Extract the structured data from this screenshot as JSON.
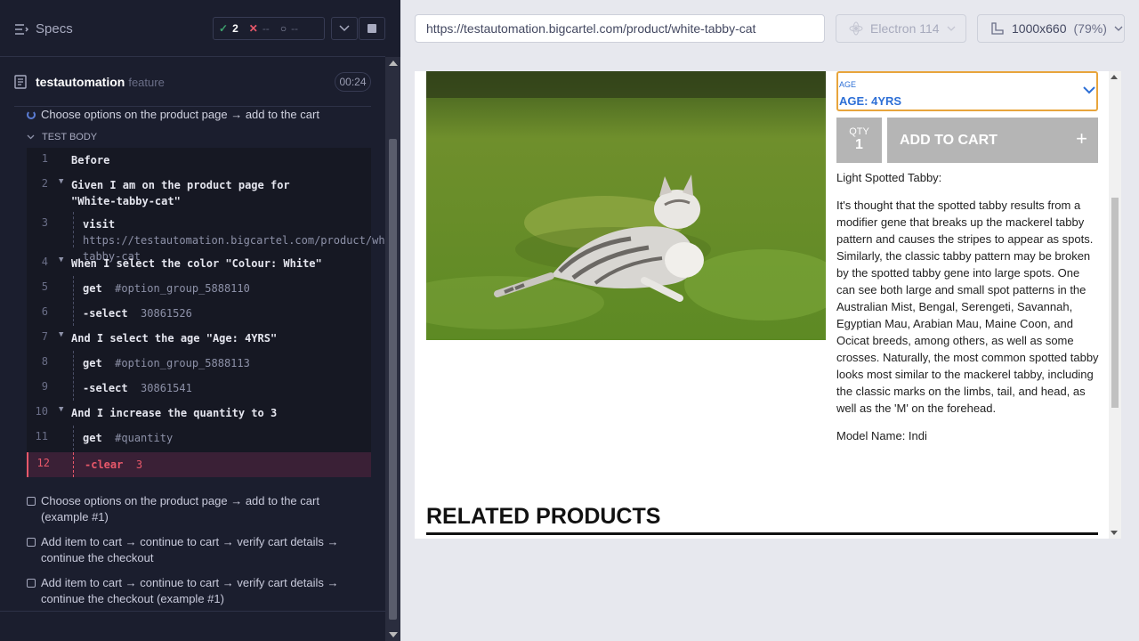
{
  "runner": {
    "specs_label": "Specs",
    "passed": "2",
    "failed": "--",
    "pending": "--",
    "file_name": "testautomation",
    "file_tag": "feature",
    "timer": "00:24",
    "running_test": "Choose options on the product page → add to the cart",
    "test_body_label": "TEST BODY",
    "commands": [
      {
        "num": "1",
        "text": "Before"
      },
      {
        "num": "2",
        "text": "Given  I am on the product page for \"White-tabby-cat\""
      },
      {
        "num": "3",
        "key": "visit",
        "value": "https://testautomation.bigcartel.com/product/white-tabby-cat"
      },
      {
        "num": "4",
        "text": "When  I select the color \"Colour: White\""
      },
      {
        "num": "5",
        "key": "get",
        "value": "#option_group_5888110"
      },
      {
        "num": "6",
        "key": "-select",
        "value": "30861526"
      },
      {
        "num": "7",
        "text": "And  I select the age \"Age: 4YRS\""
      },
      {
        "num": "8",
        "key": "get",
        "value": "#option_group_5888113"
      },
      {
        "num": "9",
        "key": "-select",
        "value": "30861541"
      },
      {
        "num": "10",
        "text": "And  I increase the quantity to 3"
      },
      {
        "num": "11",
        "key": "get",
        "value": "#quantity"
      },
      {
        "num": "12",
        "key": "-clear",
        "value": "3"
      }
    ],
    "other_tests": [
      "Choose options on the product page → add to the cart (example #1)",
      "Add item to cart → continue to cart → verify cart details → continue the checkout",
      "Add item to cart → continue to cart → verify cart details → continue the checkout (example #1)"
    ]
  },
  "browser": {
    "url": "https://testautomation.bigcartel.com/product/white-tabby-cat",
    "browser_name": "Electron 114",
    "viewport": "1000x660",
    "zoom": "(79%)"
  },
  "page": {
    "age_label": "AGE",
    "age_value": "AGE: 4YRS",
    "qty_label": "QTY",
    "qty_value": "1",
    "add_to_cart": "ADD TO CART",
    "desc_title": "Light Spotted Tabby:",
    "desc_body": "It's thought that the spotted tabby results from a modifier gene that breaks up the mackerel tabby pattern and causes the stripes to appear as spots. Similarly, the classic tabby pattern may be broken by the spotted tabby gene into large spots. One can see both large and small spot patterns in the Australian Mist, Bengal, Serengeti, Savannah, Egyptian Mau, Arabian Mau, Maine Coon, and Ocicat breeds, among others, as well as some crosses. Naturally, the most common spotted tabby looks most similar to the mackerel tabby, including the classic marks on the limbs, tail, and head, as well as the 'M' on the forehead.",
    "model_name": "Model Name: Indi",
    "related": "RELATED PRODUCTS"
  }
}
